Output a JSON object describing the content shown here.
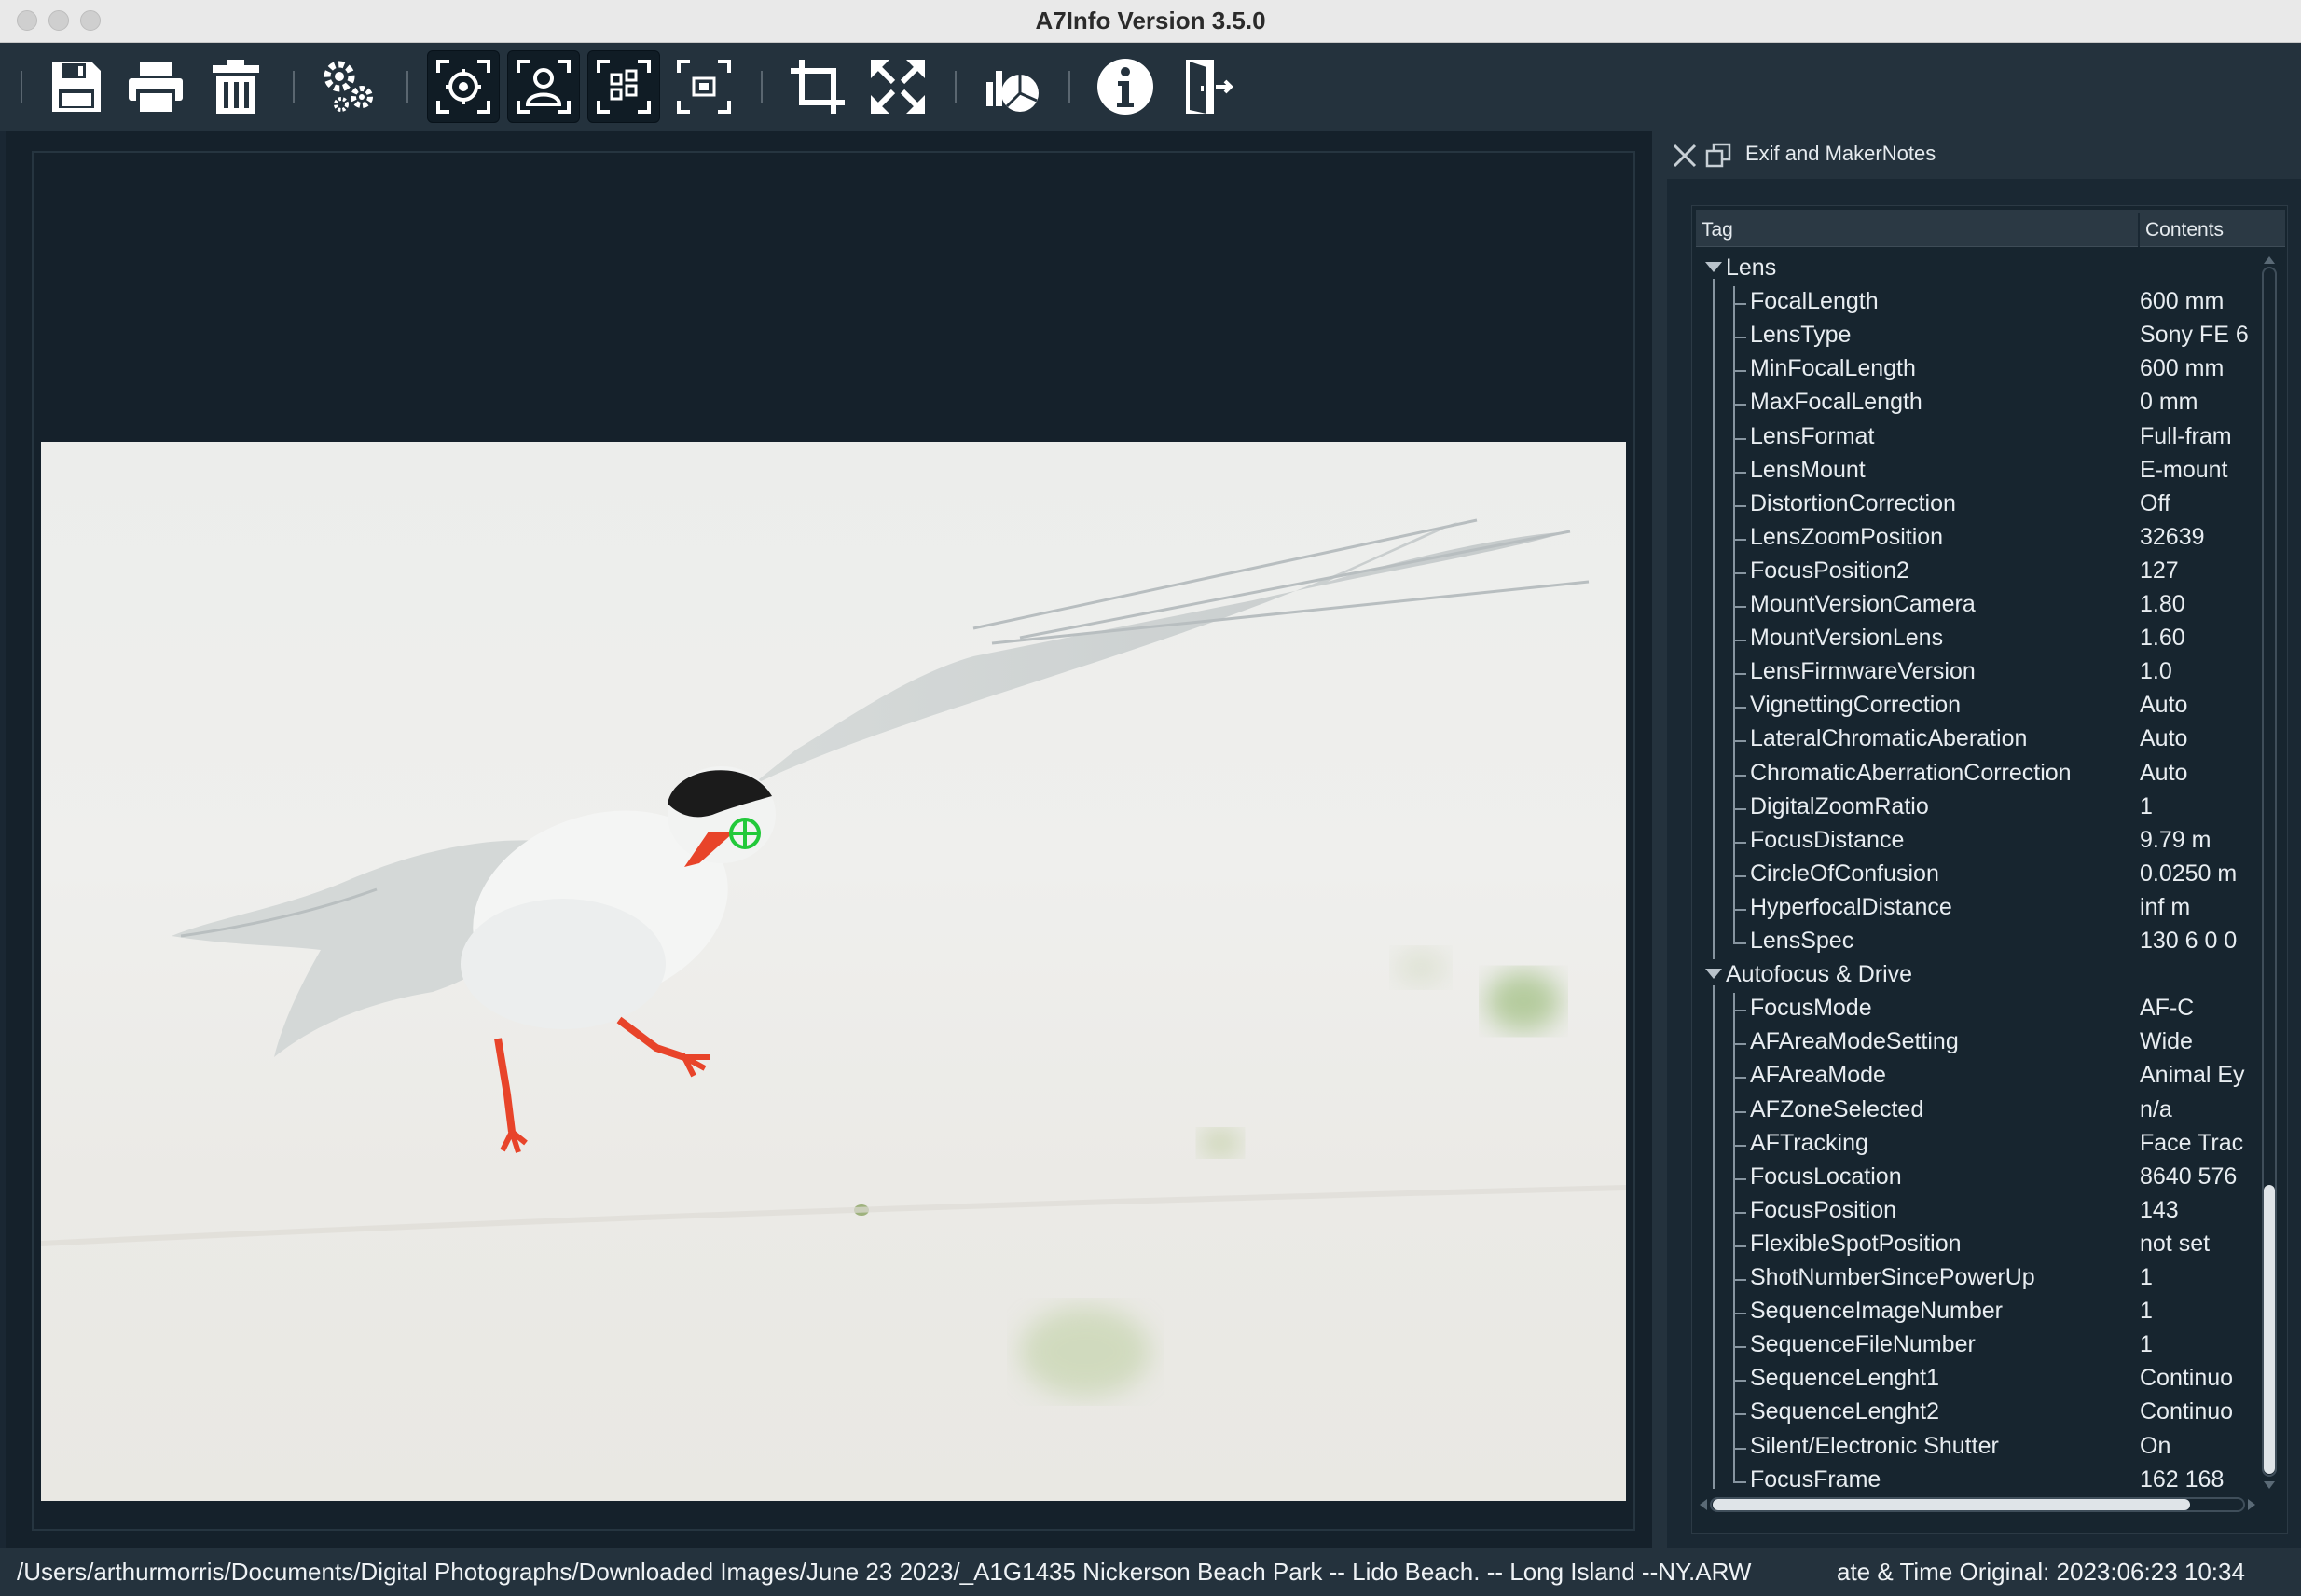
{
  "window": {
    "title": "A7Info Version 3.5.0"
  },
  "toolbar": {
    "buttons": [
      {
        "name": "save-button",
        "icon": "floppy-disk-icon"
      },
      {
        "name": "print-button",
        "icon": "printer-icon"
      },
      {
        "name": "delete-button",
        "icon": "trash-icon"
      },
      {
        "name": "settings-button",
        "icon": "gears-icon"
      },
      {
        "name": "focus-point-button",
        "icon": "focus-target-icon"
      },
      {
        "name": "face-detect-button",
        "icon": "face-frame-icon"
      },
      {
        "name": "af-area-button",
        "icon": "af-grid-icon"
      },
      {
        "name": "af-frame-button",
        "icon": "af-frame-icon"
      },
      {
        "name": "crop-button",
        "icon": "crop-icon"
      },
      {
        "name": "fullscreen-button",
        "icon": "expand-arrows-icon"
      },
      {
        "name": "statistics-button",
        "icon": "chart-icon"
      },
      {
        "name": "info-button",
        "icon": "info-circle-icon"
      },
      {
        "name": "exit-button",
        "icon": "exit-door-icon"
      }
    ]
  },
  "panel": {
    "title": "Exif and MakerNotes",
    "columns": {
      "tag": "Tag",
      "contents": "Contents"
    },
    "groups": [
      {
        "label": "Lens",
        "rows": [
          {
            "tag": "FocalLength",
            "value": "600 mm"
          },
          {
            "tag": "LensType",
            "value": "Sony FE 6"
          },
          {
            "tag": "MinFocalLength",
            "value": "600 mm"
          },
          {
            "tag": "MaxFocalLength",
            "value": "0 mm"
          },
          {
            "tag": "LensFormat",
            "value": "Full-fram"
          },
          {
            "tag": "LensMount",
            "value": "E-mount"
          },
          {
            "tag": "DistortionCorrection",
            "value": "Off"
          },
          {
            "tag": "LensZoomPosition",
            "value": "32639"
          },
          {
            "tag": "FocusPosition2",
            "value": "127"
          },
          {
            "tag": "MountVersionCamera",
            "value": "1.80"
          },
          {
            "tag": "MountVersionLens",
            "value": "1.60"
          },
          {
            "tag": "LensFirmwareVersion",
            "value": "1.0"
          },
          {
            "tag": "VignettingCorrection",
            "value": "Auto"
          },
          {
            "tag": "LateralChromaticAberation",
            "value": "Auto"
          },
          {
            "tag": "ChromaticAberrationCorrection",
            "value": "Auto"
          },
          {
            "tag": "DigitalZoomRatio",
            "value": "1"
          },
          {
            "tag": "FocusDistance",
            "value": "9.79 m"
          },
          {
            "tag": "CircleOfConfusion",
            "value": "0.0250 m"
          },
          {
            "tag": "HyperfocalDistance",
            "value": "inf m"
          },
          {
            "tag": "LensSpec",
            "value": "130 6 0 0"
          }
        ]
      },
      {
        "label": "Autofocus & Drive",
        "rows": [
          {
            "tag": "FocusMode",
            "value": "AF-C"
          },
          {
            "tag": "AFAreaModeSetting",
            "value": "Wide"
          },
          {
            "tag": "AFAreaMode",
            "value": "Animal Ey"
          },
          {
            "tag": "AFZoneSelected",
            "value": "n/a"
          },
          {
            "tag": "AFTracking",
            "value": "Face Trac"
          },
          {
            "tag": "FocusLocation",
            "value": "8640 576"
          },
          {
            "tag": "FocusPosition",
            "value": "143"
          },
          {
            "tag": "FlexibleSpotPosition",
            "value": "not set"
          },
          {
            "tag": "ShotNumberSincePowerUp",
            "value": "1"
          },
          {
            "tag": "SequenceImageNumber",
            "value": "1"
          },
          {
            "tag": "SequenceFileNumber",
            "value": "1"
          },
          {
            "tag": "SequenceLenght1",
            "value": "Continuo"
          },
          {
            "tag": "SequenceLenght2",
            "value": "Continuo"
          },
          {
            "tag": "Silent/Electronic Shutter",
            "value": "On"
          },
          {
            "tag": "FocusFrame",
            "value": "162 168"
          }
        ]
      }
    ]
  },
  "status": {
    "path": "/Users/arthurmorris/Documents/Digital Photographs/Downloaded Images/June 23 2023/_A1G1435 Nickerson Beach Park -- Lido Beach. -- Long Island --NY.ARW",
    "datetime": "ate & Time Original: 2023:06:23 10:34"
  },
  "colors": {
    "toolbar_bg": "#24323d",
    "viewer_bg": "#15212b",
    "panel_bg": "#1a2833",
    "text": "#e8edf1",
    "focus_marker": "#22c93a",
    "tern_bill": "#e8442a"
  }
}
